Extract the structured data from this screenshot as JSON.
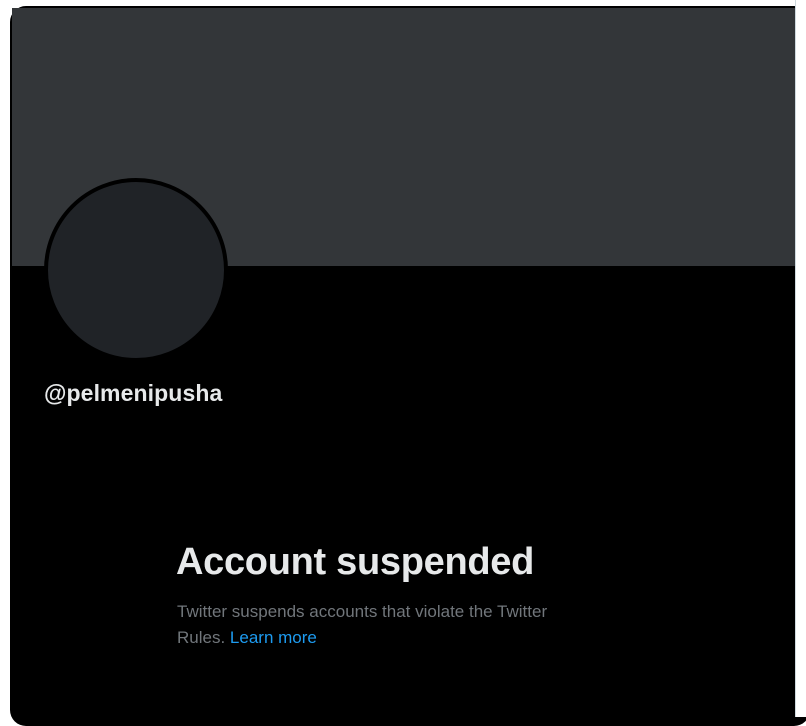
{
  "profile": {
    "handle": "@pelmenipusha"
  },
  "notice": {
    "title": "Account suspended",
    "description_line1": "Twitter suspends accounts that violate the Twitter",
    "description_line2": "Rules.",
    "learn_more_label": "Learn more"
  },
  "colors": {
    "background": "#000000",
    "banner": "#333639",
    "avatar": "#202327",
    "primary_text": "#e7e9ea",
    "secondary_text": "#71767b",
    "link": "#1d9bf0"
  }
}
